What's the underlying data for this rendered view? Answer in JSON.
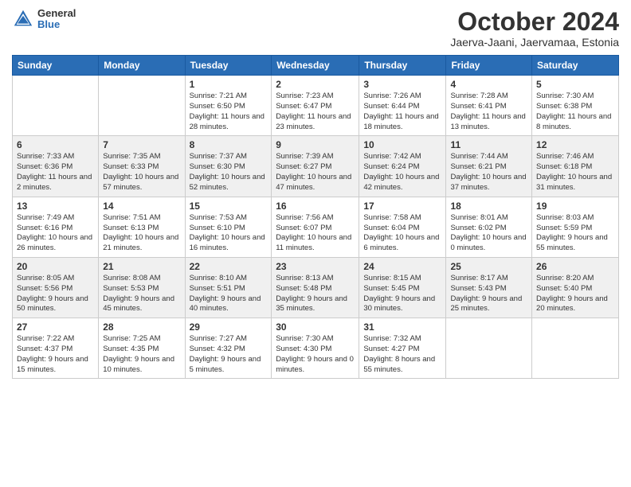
{
  "logo": {
    "general": "General",
    "blue": "Blue"
  },
  "title": {
    "month": "October 2024",
    "location": "Jaerva-Jaani, Jaervamaa, Estonia"
  },
  "headers": [
    "Sunday",
    "Monday",
    "Tuesday",
    "Wednesday",
    "Thursday",
    "Friday",
    "Saturday"
  ],
  "weeks": [
    [
      {
        "day": "",
        "info": ""
      },
      {
        "day": "",
        "info": ""
      },
      {
        "day": "1",
        "info": "Sunrise: 7:21 AM\nSunset: 6:50 PM\nDaylight: 11 hours and 28 minutes."
      },
      {
        "day": "2",
        "info": "Sunrise: 7:23 AM\nSunset: 6:47 PM\nDaylight: 11 hours and 23 minutes."
      },
      {
        "day": "3",
        "info": "Sunrise: 7:26 AM\nSunset: 6:44 PM\nDaylight: 11 hours and 18 minutes."
      },
      {
        "day": "4",
        "info": "Sunrise: 7:28 AM\nSunset: 6:41 PM\nDaylight: 11 hours and 13 minutes."
      },
      {
        "day": "5",
        "info": "Sunrise: 7:30 AM\nSunset: 6:38 PM\nDaylight: 11 hours and 8 minutes."
      }
    ],
    [
      {
        "day": "6",
        "info": "Sunrise: 7:33 AM\nSunset: 6:36 PM\nDaylight: 11 hours and 2 minutes."
      },
      {
        "day": "7",
        "info": "Sunrise: 7:35 AM\nSunset: 6:33 PM\nDaylight: 10 hours and 57 minutes."
      },
      {
        "day": "8",
        "info": "Sunrise: 7:37 AM\nSunset: 6:30 PM\nDaylight: 10 hours and 52 minutes."
      },
      {
        "day": "9",
        "info": "Sunrise: 7:39 AM\nSunset: 6:27 PM\nDaylight: 10 hours and 47 minutes."
      },
      {
        "day": "10",
        "info": "Sunrise: 7:42 AM\nSunset: 6:24 PM\nDaylight: 10 hours and 42 minutes."
      },
      {
        "day": "11",
        "info": "Sunrise: 7:44 AM\nSunset: 6:21 PM\nDaylight: 10 hours and 37 minutes."
      },
      {
        "day": "12",
        "info": "Sunrise: 7:46 AM\nSunset: 6:18 PM\nDaylight: 10 hours and 31 minutes."
      }
    ],
    [
      {
        "day": "13",
        "info": "Sunrise: 7:49 AM\nSunset: 6:16 PM\nDaylight: 10 hours and 26 minutes."
      },
      {
        "day": "14",
        "info": "Sunrise: 7:51 AM\nSunset: 6:13 PM\nDaylight: 10 hours and 21 minutes."
      },
      {
        "day": "15",
        "info": "Sunrise: 7:53 AM\nSunset: 6:10 PM\nDaylight: 10 hours and 16 minutes."
      },
      {
        "day": "16",
        "info": "Sunrise: 7:56 AM\nSunset: 6:07 PM\nDaylight: 10 hours and 11 minutes."
      },
      {
        "day": "17",
        "info": "Sunrise: 7:58 AM\nSunset: 6:04 PM\nDaylight: 10 hours and 6 minutes."
      },
      {
        "day": "18",
        "info": "Sunrise: 8:01 AM\nSunset: 6:02 PM\nDaylight: 10 hours and 0 minutes."
      },
      {
        "day": "19",
        "info": "Sunrise: 8:03 AM\nSunset: 5:59 PM\nDaylight: 9 hours and 55 minutes."
      }
    ],
    [
      {
        "day": "20",
        "info": "Sunrise: 8:05 AM\nSunset: 5:56 PM\nDaylight: 9 hours and 50 minutes."
      },
      {
        "day": "21",
        "info": "Sunrise: 8:08 AM\nSunset: 5:53 PM\nDaylight: 9 hours and 45 minutes."
      },
      {
        "day": "22",
        "info": "Sunrise: 8:10 AM\nSunset: 5:51 PM\nDaylight: 9 hours and 40 minutes."
      },
      {
        "day": "23",
        "info": "Sunrise: 8:13 AM\nSunset: 5:48 PM\nDaylight: 9 hours and 35 minutes."
      },
      {
        "day": "24",
        "info": "Sunrise: 8:15 AM\nSunset: 5:45 PM\nDaylight: 9 hours and 30 minutes."
      },
      {
        "day": "25",
        "info": "Sunrise: 8:17 AM\nSunset: 5:43 PM\nDaylight: 9 hours and 25 minutes."
      },
      {
        "day": "26",
        "info": "Sunrise: 8:20 AM\nSunset: 5:40 PM\nDaylight: 9 hours and 20 minutes."
      }
    ],
    [
      {
        "day": "27",
        "info": "Sunrise: 7:22 AM\nSunset: 4:37 PM\nDaylight: 9 hours and 15 minutes."
      },
      {
        "day": "28",
        "info": "Sunrise: 7:25 AM\nSunset: 4:35 PM\nDaylight: 9 hours and 10 minutes."
      },
      {
        "day": "29",
        "info": "Sunrise: 7:27 AM\nSunset: 4:32 PM\nDaylight: 9 hours and 5 minutes."
      },
      {
        "day": "30",
        "info": "Sunrise: 7:30 AM\nSunset: 4:30 PM\nDaylight: 9 hours and 0 minutes."
      },
      {
        "day": "31",
        "info": "Sunrise: 7:32 AM\nSunset: 4:27 PM\nDaylight: 8 hours and 55 minutes."
      },
      {
        "day": "",
        "info": ""
      },
      {
        "day": "",
        "info": ""
      }
    ]
  ]
}
